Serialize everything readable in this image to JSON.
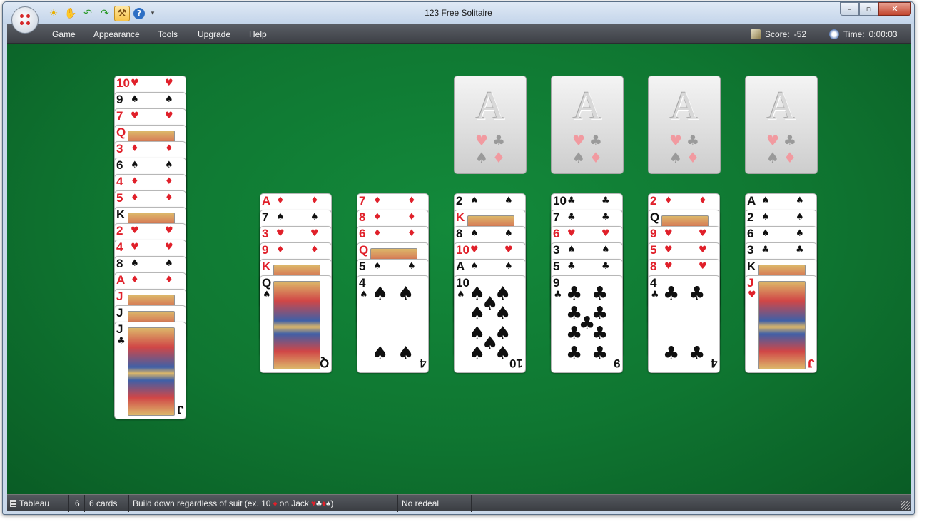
{
  "window": {
    "title": "123 Free Solitaire"
  },
  "menu": {
    "items": [
      "Game",
      "Appearance",
      "Tools",
      "Upgrade",
      "Help"
    ]
  },
  "stats": {
    "score_label": "Score:",
    "score": "-52",
    "time_label": "Time:",
    "time": "0:00:03"
  },
  "status": {
    "area": "Tableau",
    "count": "6",
    "cards": "6 cards",
    "rule_prefix": "Build down regardless of suit (ex. 10",
    "rule_mid": "on Jack",
    "rule_suffix": ")",
    "redeal": "No redeal"
  },
  "foundation_letter": "A",
  "suits": {
    "hearts": "♥",
    "diamonds": "♦",
    "clubs": "♣",
    "spades": "♠"
  },
  "colors": {
    "felt": "#0f7631",
    "red_suit": "#e0202a",
    "menubar": "#4a4d53"
  },
  "tableau": [
    {
      "cards": [
        [
          "10",
          "hearts"
        ],
        [
          "9",
          "spades"
        ],
        [
          "7",
          "hearts"
        ],
        [
          "Q",
          "diamonds"
        ],
        [
          "3",
          "diamonds"
        ],
        [
          "6",
          "spades"
        ],
        [
          "4",
          "diamonds"
        ],
        [
          "5",
          "diamonds"
        ],
        [
          "K",
          "clubs"
        ],
        [
          "2",
          "hearts"
        ],
        [
          "4",
          "hearts"
        ],
        [
          "8",
          "spades"
        ],
        [
          "A",
          "diamonds"
        ],
        [
          "J",
          "diamonds"
        ],
        [
          "J",
          "spades"
        ],
        [
          "J",
          "clubs"
        ]
      ]
    },
    {
      "cards": [
        [
          "A",
          "diamonds"
        ],
        [
          "7",
          "spades"
        ],
        [
          "3",
          "hearts"
        ],
        [
          "9",
          "diamonds"
        ],
        [
          "K",
          "diamonds"
        ],
        [
          "Q",
          "spades"
        ]
      ]
    },
    {
      "cards": [
        [
          "7",
          "diamonds"
        ],
        [
          "8",
          "diamonds"
        ],
        [
          "6",
          "diamonds"
        ],
        [
          "Q",
          "hearts"
        ],
        [
          "5",
          "spades"
        ],
        [
          "4",
          "spades"
        ]
      ]
    },
    {
      "cards": [
        [
          "2",
          "spades"
        ],
        [
          "K",
          "hearts"
        ],
        [
          "8",
          "spades"
        ],
        [
          "10",
          "hearts"
        ],
        [
          "A",
          "spades"
        ],
        [
          "10",
          "spades"
        ]
      ]
    },
    {
      "cards": [
        [
          "10",
          "clubs"
        ],
        [
          "7",
          "clubs"
        ],
        [
          "6",
          "hearts"
        ],
        [
          "3",
          "spades"
        ],
        [
          "5",
          "clubs"
        ],
        [
          "9",
          "clubs"
        ]
      ]
    },
    {
      "cards": [
        [
          "2",
          "diamonds"
        ],
        [
          "Q",
          "clubs"
        ],
        [
          "9",
          "hearts"
        ],
        [
          "5",
          "hearts"
        ],
        [
          "8",
          "hearts"
        ],
        [
          "4",
          "clubs"
        ]
      ]
    },
    {
      "cards": [
        [
          "A",
          "spades"
        ],
        [
          "2",
          "spades"
        ],
        [
          "6",
          "spades"
        ],
        [
          "3",
          "clubs"
        ],
        [
          "K",
          "clubs"
        ],
        [
          "J",
          "hearts"
        ]
      ]
    }
  ]
}
